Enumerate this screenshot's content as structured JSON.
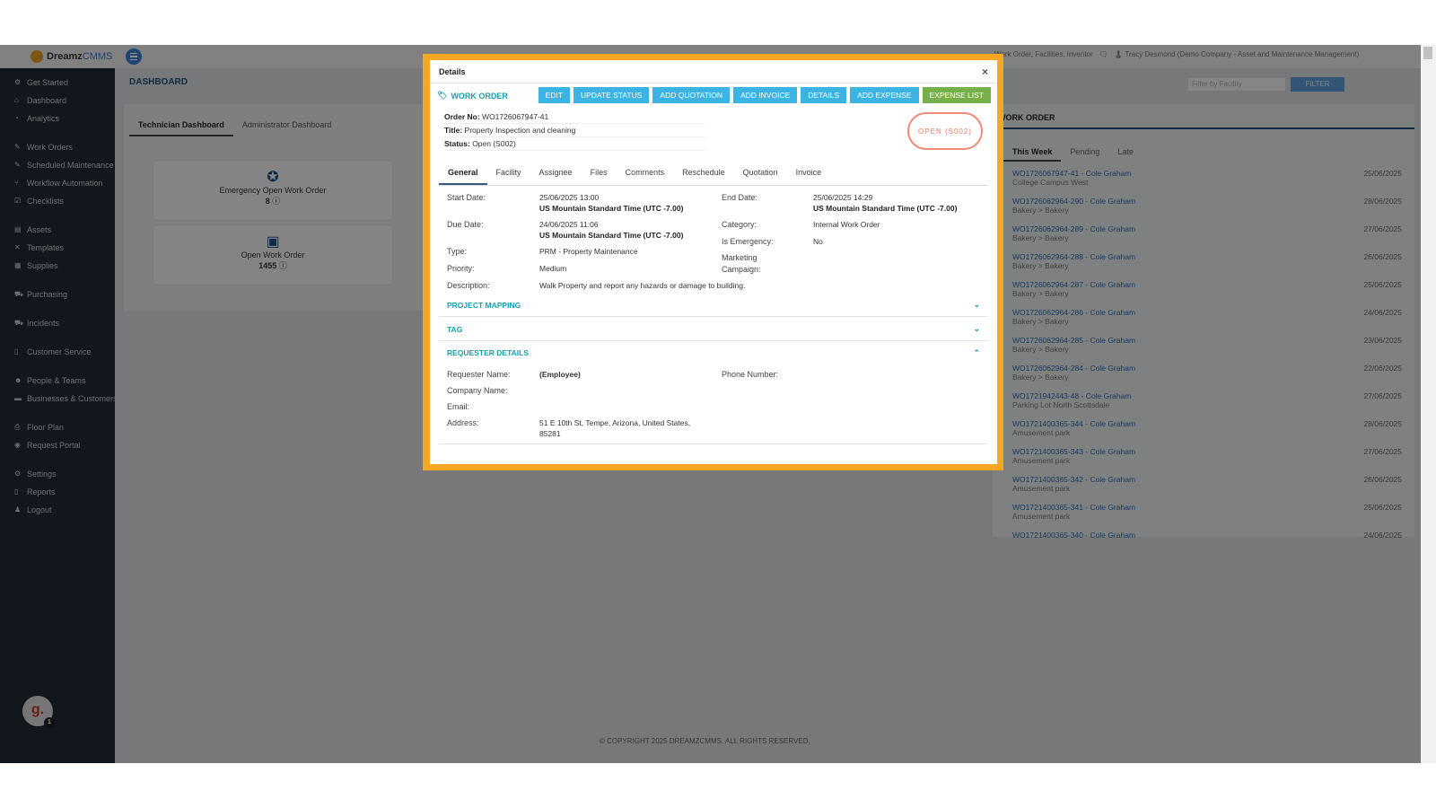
{
  "app": {
    "logo_name": "Dreamz",
    "logo_accent": "CMMS"
  },
  "sidebar": {
    "items": [
      {
        "label": "Get Started",
        "icon": "gear-icon"
      },
      {
        "label": "Dashboard",
        "icon": "home-icon"
      },
      {
        "label": "Analytics",
        "icon": "chart-icon"
      },
      {
        "label": "Work Orders",
        "icon": "wrench-icon"
      },
      {
        "label": "Scheduled Maintenance",
        "icon": "wrench-icon"
      },
      {
        "label": "Workflow Automation",
        "icon": "flow-icon"
      },
      {
        "label": "Checklists",
        "icon": "check-icon"
      },
      {
        "label": "Assets",
        "icon": "asset-icon"
      },
      {
        "label": "Templates",
        "icon": "template-icon"
      },
      {
        "label": "Supplies",
        "icon": "supply-icon"
      },
      {
        "label": "Purchasing",
        "icon": "cart-icon"
      },
      {
        "label": "Incidents",
        "icon": "alert-icon"
      },
      {
        "label": "Customer Service",
        "icon": "doc-icon"
      },
      {
        "label": "People & Teams",
        "icon": "people-icon"
      },
      {
        "label": "Businesses & Customers",
        "icon": "business-icon"
      },
      {
        "label": "Floor Plan",
        "icon": "floor-icon"
      },
      {
        "label": "Request Portal",
        "icon": "chat-icon"
      },
      {
        "label": "Settings",
        "icon": "gear-icon"
      },
      {
        "label": "Reports",
        "icon": "doc-icon"
      },
      {
        "label": "Logout",
        "icon": "user-icon"
      }
    ]
  },
  "topbar": {
    "search_hint": "Work Order, Facilities, Inventor",
    "user": "Tracy Desmond (Demo Company - Asset and Maintenance Management)"
  },
  "dashboard": {
    "title": "DASHBOARD",
    "tabs": [
      "Technician Dashboard",
      "Administrator Dashboard"
    ],
    "cards": [
      {
        "label": "Emergency Open Work Order",
        "value": "8"
      },
      {
        "label": "Open Work Order",
        "value": "1455"
      }
    ]
  },
  "wo_panel": {
    "title": "WORK ORDER",
    "filter_placeholder": "Filter by Facility",
    "filter_button": "FILTER",
    "tabs": [
      "This Week",
      "Pending",
      "Late"
    ],
    "rows": [
      {
        "id": "WO1726067947-41 - Cole Graham",
        "sub": "College Campus West",
        "date": "25/06/2025"
      },
      {
        "id": "WO1726062964-290 - Cole Graham",
        "sub": "Bakery > Bakery",
        "date": "28/06/2025"
      },
      {
        "id": "WO1726062964-289 - Cole Graham",
        "sub": "Bakery > Bakery",
        "date": "27/06/2025"
      },
      {
        "id": "WO1726062964-288 - Cole Graham",
        "sub": "Bakery > Bakery",
        "date": "26/06/2025"
      },
      {
        "id": "WO1726062964-287 - Cole Graham",
        "sub": "Bakery > Bakery",
        "date": "25/06/2025"
      },
      {
        "id": "WO1726062964-286 - Cole Graham",
        "sub": "Bakery > Bakery",
        "date": "24/06/2025"
      },
      {
        "id": "WO1726062964-285 - Cole Graham",
        "sub": "Bakery > Bakery",
        "date": "23/06/2025"
      },
      {
        "id": "WO1726062964-284 - Cole Graham",
        "sub": "Bakery > Bakery",
        "date": "22/06/2025"
      },
      {
        "id": "WO1721942443-48 - Cole Graham",
        "sub": "Parking Lot North Scottsdale",
        "date": "27/06/2025"
      },
      {
        "id": "WO1721400365-344 - Cole Graham",
        "sub": "Amusement park",
        "date": "28/06/2025"
      },
      {
        "id": "WO1721400365-343 - Cole Graham",
        "sub": "Amusement park",
        "date": "27/06/2025"
      },
      {
        "id": "WO1721400365-342 - Cole Graham",
        "sub": "Amusement park",
        "date": "26/06/2025"
      },
      {
        "id": "WO1721400365-341 - Cole Graham",
        "sub": "Amusement park",
        "date": "25/06/2025"
      },
      {
        "id": "WO1721400365-340 - Cole Graham",
        "sub": "",
        "date": "24/06/2025"
      }
    ]
  },
  "copyright": "© COPYRIGHT 2025 DREAMZCMMS. ALL RIGHTS RESERVED.",
  "modal": {
    "title": "Details",
    "close": "×",
    "section_title": "WORK ORDER",
    "buttons": [
      "EDIT",
      "UPDATE STATUS",
      "ADD QUOTATION",
      "ADD INVOICE",
      "DETAILS",
      "ADD EXPENSE",
      "EXPENSE LIST"
    ],
    "order_no_label": "Order No:",
    "order_no": "WO1726067947-41",
    "title_label": "Title:",
    "title_value": "Property Inspection and cleaning",
    "status_label": "Status:",
    "status_value": "Open (S002)",
    "stamp": "OPEN (S002)",
    "tabs": [
      "General",
      "Facility",
      "Assignee",
      "Files",
      "Comments",
      "Reschedule",
      "Quotation",
      "Invoice"
    ],
    "general": {
      "start_label": "Start Date:",
      "start_date": "25/06/2025 13:00",
      "start_tz": "US Mountain Standard Time (UTC -7.00)",
      "end_label": "End Date:",
      "end_date": "25/06/2025 14:29",
      "end_tz": "US Mountain Standard Time (UTC -7.00)",
      "due_label": "Due Date:",
      "due_date": "24/06/2025 11:06",
      "due_tz": "US Mountain Standard Time (UTC -7.00)",
      "category_label": "Category:",
      "category": "Internal Work Order",
      "emergency_label": "Is Emergency:",
      "emergency": "No",
      "type_label": "Type:",
      "type": "PRM - Property Maintenance",
      "marketing_label1": "Marketing",
      "marketing_label2": "Campaign:",
      "priority_label": "Priority:",
      "priority": "Medium",
      "description_label": "Description:",
      "description": "Walk Property and report any hazards or damage to building."
    },
    "sections": [
      "PROJECT MAPPING",
      "TAG",
      "REQUESTER DETAILS"
    ],
    "requester": {
      "name_label": "Requester Name:",
      "name": "(Employee)",
      "phone_label": "Phone Number:",
      "company_label": "Company Name:",
      "email_label": "Email:",
      "address_label": "Address:",
      "address1": "51 E 10th St, Tempe, Arizona, United States,",
      "address2": "85281"
    }
  },
  "avatar": {
    "letter": "g.",
    "badge": "1"
  },
  "colors": {
    "accent": "#3bb3e3",
    "section": "#1a9fb0",
    "modal_border": "#f5a623",
    "sidebar": "#1f2a33"
  }
}
